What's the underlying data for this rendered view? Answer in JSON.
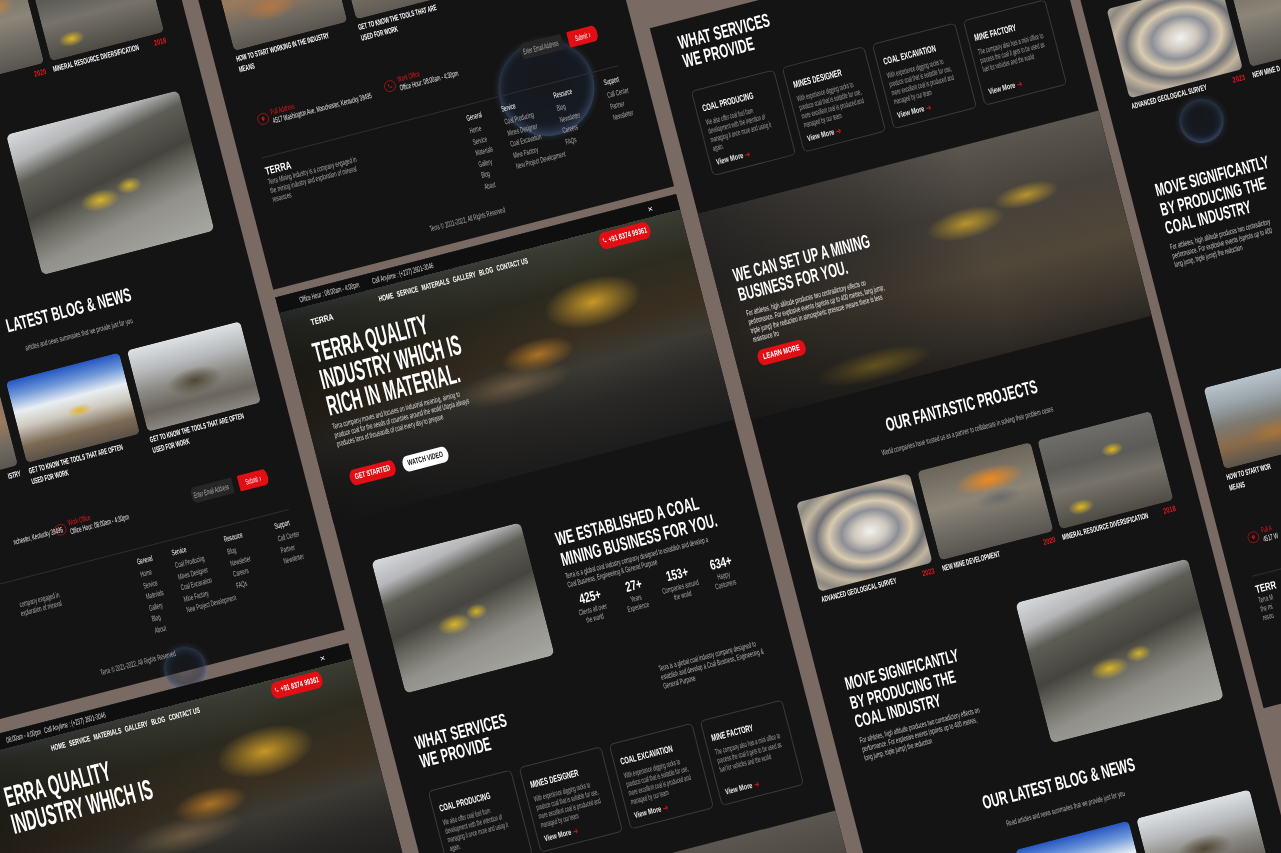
{
  "columns": [
    {
      "pages": [
        {
          "sections": [
            {
              "kind": "projects",
              "cards": [
                {
                  "photo": true,
                  "year": "2020"
                },
                {
                  "photo": true,
                  "title": "MINERAL RESOURCE DIVERSIFICATION",
                  "year": "2018"
                }
              ]
            },
            {
              "kind": "feature",
              "photo": true
            },
            {
              "kind": "blog",
              "title": "LATEST BLOG & NEWS",
              "subtitle": "articles and news summaries that we provide just for you",
              "cards": [
                {
                  "photo": true,
                  "title": [
                    "ISTRY"
                  ]
                },
                {
                  "photo": true,
                  "title": [
                    "GET TO KNOW THE TOOLS THAT ARE OFTEN",
                    "USED FOR WORK"
                  ]
                },
                {
                  "photo": true,
                  "title": [
                    "GET TO KNOW THE TOOLS THAT ARE OFTEN",
                    "USED FOR WORK"
                  ]
                }
              ]
            },
            {
              "kind": "footer",
              "contacts": [
                {
                  "kind": "address",
                  "text": "nchester, Kentucky 39495"
                },
                {
                  "kind": "office",
                  "icon": true,
                  "label": "Work Office",
                  "text": "Office Hour: 08:00am - 4:30pm"
                }
              ],
              "newsletter": {
                "placeholder": "Enter Email Address",
                "button": "Submit"
              },
              "description": [
                "company engaged in",
                "exploration of mineral"
              ],
              "link_columns": [
                {
                  "heading": "General",
                  "links": [
                    "Home",
                    "Service",
                    "Materials",
                    "Gallery",
                    "Blog",
                    "About"
                  ]
                },
                {
                  "heading": "Service",
                  "links": [
                    "Coal Producing",
                    "Mines Designer",
                    "Coal Excavation",
                    "Mine Factory",
                    "New Project Development"
                  ]
                },
                {
                  "heading": "Resource",
                  "links": [
                    "Blog",
                    "Newsletter",
                    "Careers",
                    "FAQs"
                  ]
                },
                {
                  "heading": "Support",
                  "links": [
                    "Call Center",
                    "Partner",
                    "Newsletter"
                  ]
                }
              ],
              "copyright": "Terra © 2021-2022, All Rights Reserved"
            }
          ]
        },
        {
          "sections": [
            {
              "kind": "hero",
              "photo": true,
              "topbar": {
                "office_hours": "08:00am - 4:00pm",
                "call": "Call Anytime : (+237) 2601-3046",
                "close": "×"
              },
              "nav": [
                "HOME",
                "SERVICE",
                "MATERIALS",
                "GALLERY",
                "BLOG",
                "CONTACT US"
              ],
              "phone": "+91 8374 99361",
              "title": [
                "ERRA QUALITY",
                "INDUSTRY WHICH IS"
              ]
            }
          ]
        }
      ]
    },
    {
      "pages": [
        {
          "sections": [
            {
              "kind": "blog",
              "cards": [
                {
                  "photo": true,
                  "title": [
                    "HOW TO START WORKING IN THE INDUSTRY",
                    "MEANS"
                  ]
                },
                {
                  "photo": true,
                  "title": [
                    "GET TO KNOW THE TOOLS THAT ARE",
                    "USED FOR WORK"
                  ]
                }
              ]
            },
            {
              "kind": "footer",
              "contacts": [
                {
                  "kind": "address",
                  "icon": true,
                  "label": "Full Address",
                  "text": "4517 Washington Ave. Manchester, Kentucky 39495"
                },
                {
                  "kind": "office",
                  "icon": true,
                  "label": "Work Office",
                  "text": "Office Hour: 08:00am - 4:30pm"
                }
              ],
              "newsletter": {
                "placeholder": "Enter Email Address",
                "button": "Submit"
              },
              "logo": "TERRA",
              "description": [
                "Terra Mining Industry is a company engaged in",
                "the mining industry and exploration of mineral",
                "resources"
              ],
              "link_columns": [
                {
                  "heading": "General",
                  "links": [
                    "Home",
                    "Service",
                    "Materials",
                    "Gallery",
                    "Blog",
                    "About"
                  ]
                },
                {
                  "heading": "Service",
                  "links": [
                    "Coal Producing",
                    "Mines Designer",
                    "Coal Excavation",
                    "Mine Factory",
                    "New Project Development"
                  ]
                },
                {
                  "heading": "Resource",
                  "links": [
                    "Blog",
                    "Newsletter",
                    "Careers",
                    "FAQs"
                  ]
                },
                {
                  "heading": "Support",
                  "links": [
                    "Call Center",
                    "Partner",
                    "Newsletter"
                  ]
                }
              ],
              "copyright": "Terra © 2021-2022, All Rights Reserved"
            }
          ]
        },
        {
          "sections": [
            {
              "kind": "hero",
              "photo": true,
              "topbar": {
                "office_hours": "Office Hour : 08:00am - 4:00pm",
                "call": "Call Anytime : (+237) 2601-3046",
                "close": "×"
              },
              "logo": "TERRA",
              "nav": [
                "HOME",
                "SERVICE",
                "MATERIALS",
                "GALLERY",
                "BLOG",
                "CONTACT US"
              ],
              "phone": "+91 8374 99361",
              "title": [
                "TERRA QUALITY",
                "INDUSTRY WHICH IS",
                "RICH IN MATERIAL."
              ],
              "text": [
                "Terra company moves and focuses on industrial meaning, aiming to",
                "produce coal for the needs of countries around the world Utopia always",
                "produces tons of thousands of coal every day to prepare"
              ],
              "buttons": [
                {
                  "label": "GET STARTED",
                  "kind": "primary"
                },
                {
                  "label": "WATCH VIDEO",
                  "kind": "secondary"
                }
              ]
            },
            {
              "kind": "about",
              "photo": true,
              "title": [
                "WE ESTABLISHED A COAL",
                "MINING BUSINESS FOR YOU."
              ],
              "text": [
                "Terra is a global coal industry company designed to establish and develop a",
                "Coal Business, Engineering & General Purpose"
              ],
              "stats": [
                {
                  "value": "425+",
                  "label": [
                    "Clients all over",
                    "the world"
                  ]
                },
                {
                  "value": "27+",
                  "label": [
                    "Years",
                    "Experience"
                  ]
                },
                {
                  "value": "153+",
                  "label": [
                    "Companies around",
                    "the world"
                  ]
                },
                {
                  "value": "634+",
                  "label": [
                    "Happy",
                    "Costumers"
                  ]
                }
              ]
            },
            {
              "kind": "services",
              "title": [
                "WHAT SERVICES",
                "WE PROVIDE"
              ],
              "text": [
                "Terra is a global coal industry company designed to",
                "establish and develop a Coal Business, Engineering &",
                "General Purpose"
              ],
              "cards": [
                {
                  "title": "COAL PRODUCING",
                  "text": [
                    "We also offer coal fuel from",
                    "development with the intention of",
                    "managing it once more and using it",
                    "again."
                  ]
                },
                {
                  "title": "MINES DESIGNER",
                  "text": [
                    "With experience digging rocks to",
                    "produce coal that is suitable for use,",
                    "more excellent coal is produced and",
                    "managed by our team"
                  ],
                  "link": "View More"
                },
                {
                  "title": "COAL EXCAVATION",
                  "text": [
                    "With experience digging rocks to",
                    "produce coal that is suitable for use,",
                    "more excellent coal is produced and",
                    "managed by our team"
                  ],
                  "link": "View More"
                },
                {
                  "title": "MINE FACTORY",
                  "text": [
                    "The company also has a mini office to",
                    "process the coal it gets to be used as",
                    "fuel for vehicles and the world"
                  ],
                  "link": "View More"
                }
              ]
            },
            {
              "kind": "banner",
              "photo": true
            }
          ]
        }
      ]
    },
    {
      "pages": [
        {
          "sections": [
            {
              "kind": "services",
              "title": [
                "WHAT SERVICES",
                "WE PROVIDE"
              ],
              "cards": [
                {
                  "title": "COAL PRODUCING",
                  "text": [
                    "We also offer coal fuel from",
                    "development with the intention of",
                    "managing it once more and using it",
                    "again."
                  ],
                  "link": "View More"
                },
                {
                  "title": "MINES DESIGNER",
                  "text": [
                    "With experience digging rocks to",
                    "produce coal that is suitable for use,",
                    "more excellent coal is produced and",
                    "managed by our team"
                  ],
                  "link": "View More"
                },
                {
                  "title": "COAL EXCAVATION",
                  "text": [
                    "With experience digging rocks to",
                    "produce coal that is suitable for use,",
                    "more excellent coal is produced and",
                    "managed by our team"
                  ],
                  "link": "View More"
                },
                {
                  "title": "MINE FACTORY",
                  "text": [
                    "The company also has a mini office to",
                    "process the coal it gets to be used as",
                    "fuel for vehicles and the world"
                  ],
                  "link": "View More"
                }
              ]
            },
            {
              "kind": "banner",
              "photo": true,
              "title": [
                "WE CAN SET UP A MINING",
                "BUSINESS FOR YOU."
              ],
              "text": [
                "For athletes, high altitude produces two contradictory effects on",
                "performance. For explosive events (sprints up to 400 metres, long jump,",
                "triple jump) the reduction in atmospheric pressure means there is less",
                "resistance fro"
              ],
              "button": "LEARN MORE"
            },
            {
              "kind": "projects",
              "title": "OUR FANTASTIC PROJECTS",
              "subtitle": "World companies have trusted us as a partner to collaborate in solving their problem cases",
              "cards": [
                {
                  "photo": true,
                  "title": "ADVANCED GEOLOGICAL SURVEY",
                  "year": "2023"
                },
                {
                  "photo": true,
                  "title": "NEW MINE DEVELOPMENT",
                  "year": "2020"
                },
                {
                  "photo": true,
                  "title": "MINERAL RESOURCE DIVERSIFICATION",
                  "year": "2018"
                }
              ]
            },
            {
              "kind": "feature",
              "photo": true,
              "title": [
                "MOVE SIGNIFICANTLY",
                "BY PRODUCING THE",
                "COAL INDUSTRY"
              ],
              "text": [
                "For athletes, high altitude produces two contradictory effects on",
                "performance. For explosive events (sprints up to 400 metres,",
                "long jump, triple jump) the reduction"
              ]
            },
            {
              "kind": "blog",
              "title": "OUR LATEST BLOG & NEWS",
              "subtitle": "Read articles and news summaries that we provide just for you",
              "cards": [
                {
                  "photo": true
                },
                {
                  "photo": true
                }
              ]
            }
          ]
        }
      ]
    },
    {
      "pages": [
        {
          "sections": [
            {
              "kind": "projects",
              "cards": [
                {
                  "photo": true,
                  "title": "ADVANCED GEOLOGICAL SURVEY",
                  "year": "2023"
                },
                {
                  "photo": true,
                  "title": "NEW MINE D"
                }
              ]
            },
            {
              "kind": "feature",
              "title": [
                "MOVE SIGNIFICANTLY",
                "BY PRODUCING THE",
                "COAL INDUSTRY"
              ],
              "text": [
                "For athletes, high altitude produces two contradictory",
                "performance. For explosive events (sprints up to 400",
                "long jump, triple jump) the reduction"
              ]
            },
            {
              "kind": "blog",
              "cards": [
                {
                  "photo": true,
                  "title": [
                    "HOW TO START WOR",
                    "MEANS"
                  ]
                }
              ]
            },
            {
              "kind": "footer",
              "contacts": [
                {
                  "kind": "address",
                  "icon": true,
                  "label": "Full A",
                  "text": "4517 W"
                }
              ],
              "logo": "TERR",
              "description": [
                "Terra M",
                "the mi",
                "resou"
              ]
            }
          ]
        }
      ]
    }
  ]
}
